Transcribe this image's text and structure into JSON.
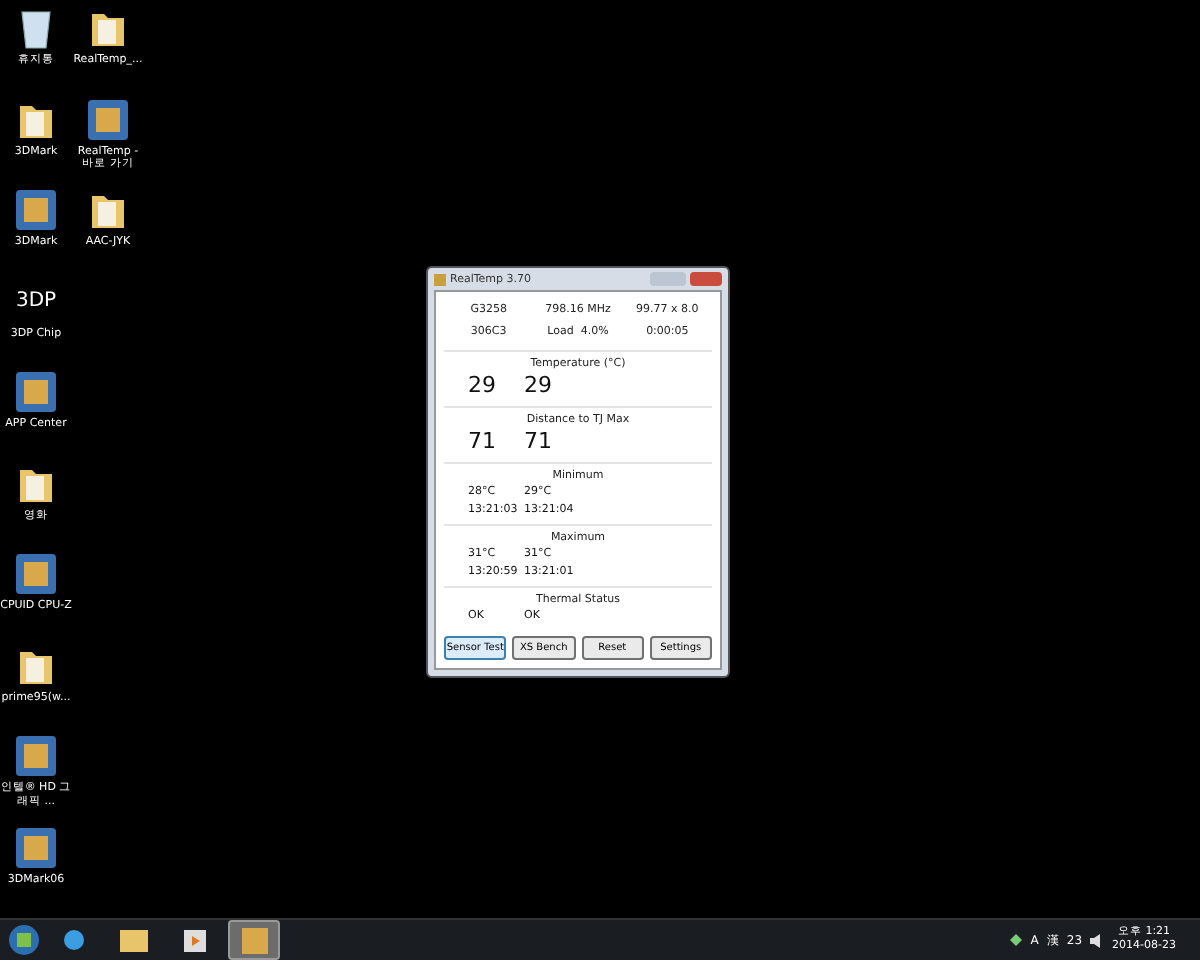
{
  "desktop_icons": [
    [
      {
        "label": "휴지통",
        "kind": "bin"
      },
      {
        "label": "RealTemp_...",
        "kind": "folder"
      }
    ],
    [
      {
        "label": "3DMark",
        "kind": "folder"
      },
      {
        "label": "RealTemp - 바로 가기",
        "kind": "app"
      }
    ],
    [
      {
        "label": "3DMark",
        "kind": "app"
      },
      {
        "label": "AAC-JYK",
        "kind": "folder"
      }
    ],
    [
      {
        "label": "3DP Chip",
        "kind": "text",
        "glyph": "3DP"
      }
    ],
    [
      {
        "label": "APP Center",
        "kind": "app"
      }
    ],
    [
      {
        "label": "영화",
        "kind": "folder"
      }
    ],
    [
      {
        "label": "CPUID CPU-Z",
        "kind": "app"
      }
    ],
    [
      {
        "label": "prime95(w...",
        "kind": "folder"
      }
    ],
    [
      {
        "label": "인텔® HD 그래픽 ...",
        "kind": "app"
      }
    ],
    [
      {
        "label": "3DMark06",
        "kind": "app"
      }
    ]
  ],
  "window": {
    "title": "RealTemp 3.70",
    "info_rows": [
      [
        "G3258",
        "798.16 MHz",
        "99.77 x 8.0"
      ],
      [
        "306C3",
        "Load  4.0%",
        "0:00:05"
      ]
    ],
    "sections": [
      {
        "heading": "Temperature (°C)",
        "kind": "big",
        "rows": [
          [
            "29",
            "29"
          ]
        ]
      },
      {
        "heading": "Distance to TJ Max",
        "kind": "big",
        "rows": [
          [
            "71",
            "71"
          ]
        ]
      },
      {
        "heading": "Minimum",
        "kind": "small",
        "rows": [
          [
            "28°C",
            "29°C"
          ],
          [
            "13:21:03",
            "13:21:04"
          ]
        ]
      },
      {
        "heading": "Maximum",
        "kind": "small",
        "rows": [
          [
            "31°C",
            "31°C"
          ],
          [
            "13:20:59",
            "13:21:01"
          ]
        ]
      },
      {
        "heading": "Thermal Status",
        "kind": "small",
        "rows": [
          [
            "OK",
            "OK"
          ]
        ]
      }
    ],
    "buttons": [
      {
        "label": "Sensor Test",
        "selected": true
      },
      {
        "label": "XS Bench",
        "selected": false
      },
      {
        "label": "Reset",
        "selected": false
      },
      {
        "label": "Settings",
        "selected": false
      }
    ]
  },
  "taskbar": {
    "apps": [
      {
        "kind": "ie",
        "active": false
      },
      {
        "kind": "explorer",
        "active": false
      },
      {
        "kind": "media",
        "active": false
      },
      {
        "kind": "realtemp",
        "active": true
      }
    ],
    "ime": [
      "A",
      "漢"
    ],
    "tray_number": "23",
    "time": "오후 1:21",
    "date": "2014-08-23"
  }
}
